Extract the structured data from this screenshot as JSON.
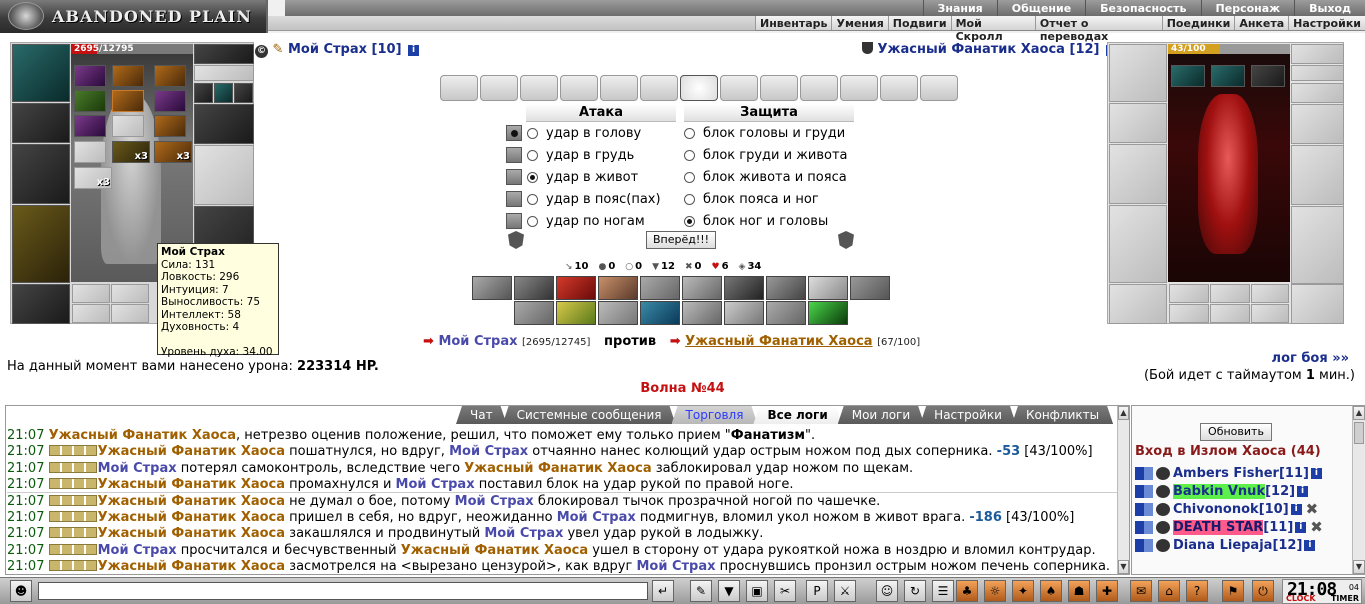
{
  "logo": {
    "text": "ABANDONED PLAIN"
  },
  "menu_top": [
    "Знания",
    "Общение",
    "Безопасность",
    "Персонаж",
    "Выход"
  ],
  "menu_sub": [
    "Инвентарь",
    "Умения",
    "Подвиги",
    "Мой Скролл",
    "Отчет о переводах",
    "Поединки",
    "Анкета",
    "Настройки"
  ],
  "player": {
    "name": "Мой Страх",
    "level": "[10]",
    "hp": "2695/12795",
    "hp_fraction": 0.21,
    "multipliers": [
      "x3",
      "x3",
      "x3"
    ],
    "tooltip": {
      "title": "Мой Страх",
      "lines": [
        "Сила: 131",
        "Ловкость: 296",
        "Интуиция: 7",
        "Выносливость: 75",
        "Интеллект: 58",
        "Духовность: 4"
      ],
      "spirit": "Уровень духа: 34.00"
    }
  },
  "enemy": {
    "name": "Ужасный Фанатик Хаоса",
    "level": "[12]",
    "hp": "43/100",
    "hp_fraction": 0.43
  },
  "combat": {
    "attack_header": "Атака",
    "defense_header": "Защита",
    "attacks": [
      {
        "label": "удар в голову",
        "checked": true,
        "selected": false
      },
      {
        "label": "удар в грудь",
        "checked": false,
        "selected": false
      },
      {
        "label": "удар в живот",
        "checked": false,
        "selected": true
      },
      {
        "label": "удар в пояс(пах)",
        "checked": false,
        "selected": false
      },
      {
        "label": "удар по ногам",
        "checked": false,
        "selected": false
      }
    ],
    "defenses": [
      {
        "label": "блок головы и груди",
        "selected": false
      },
      {
        "label": "блок груди и живота",
        "selected": false
      },
      {
        "label": "блок живота и пояса",
        "selected": false
      },
      {
        "label": "блок пояса и ног",
        "selected": false
      },
      {
        "label": "блок ног и головы",
        "selected": true
      }
    ],
    "forward_button": "Вперёд!!!",
    "stats": [
      "10",
      "0",
      "0",
      "12",
      "0",
      "6",
      "34"
    ]
  },
  "versus": {
    "me": "Мой Страх",
    "me_hp": "[2695/12745]",
    "word": "против",
    "foe": "Ужасный Фанатик Хаоса",
    "foe_hp": "[67/100]"
  },
  "damage": {
    "label": "На данный момент вами нанесено урона:",
    "value": "223314 HP."
  },
  "battle_log_link": "лог боя »»",
  "timeout": {
    "prefix": "(Бой идет с таймаутом ",
    "value": "1",
    "suffix": " мин.)"
  },
  "wave": "Волна №44",
  "chat_tabs": [
    "Чат",
    "Системные сообщения",
    "Торговля",
    "Все логи",
    "Мои логи",
    "Настройки",
    "Конфликты"
  ],
  "log": [
    {
      "time": "21:07",
      "boxes": false,
      "actor": "Ужасный Фанатик Хаоса",
      "actor_type": "foe",
      "parts": [
        {
          "t": ", нетрезво оценив положение, решил, что поможет ему только прием \""
        },
        {
          "b": "Фанатизм"
        },
        {
          "t": "\"."
        }
      ]
    },
    {
      "time": "21:07",
      "boxes": true,
      "actor": "Ужасный Фанатик Хаоса",
      "actor_type": "foe",
      "parts": [
        {
          "t": " пошатнулся, но вдруг, "
        },
        {
          "n2": "Мой Страх"
        },
        {
          "t": " отчаянно нанес колющий удар острым ножом под дых соперника. "
        },
        {
          "d": "-53"
        },
        {
          "t": " [43/100%]"
        }
      ]
    },
    {
      "time": "21:07",
      "boxes": true,
      "actor": "Мой Страх",
      "actor_type": "me",
      "parts": [
        {
          "t": " потерял самоконтроль, вследствие чего "
        },
        {
          "n1": "Ужасный Фанатик Хаоса"
        },
        {
          "t": " заблокировал удар ножом по щекам."
        }
      ]
    },
    {
      "time": "21:07",
      "boxes": true,
      "actor": "Ужасный Фанатик Хаоса",
      "actor_type": "foe",
      "parts": [
        {
          "t": " промахнулся и "
        },
        {
          "n2": "Мой Страх"
        },
        {
          "t": " поставил блок на удар рукой по правой ноге."
        }
      ]
    },
    {
      "time": "21:07",
      "boxes": true,
      "actor": "Ужасный Фанатик Хаоса",
      "actor_type": "foe",
      "parts": [
        {
          "t": " не думал о бое, потому "
        },
        {
          "n2": "Мой Страх"
        },
        {
          "t": " блокировал тычок прозрачной ногой по чашечке."
        }
      ]
    },
    {
      "time": "21:07",
      "boxes": true,
      "actor": "Ужасный Фанатик Хаоса",
      "actor_type": "foe",
      "parts": [
        {
          "t": " пришел в себя, но вдруг, неожиданно "
        },
        {
          "n2": "Мой Страх"
        },
        {
          "t": " подмигнув, вломил укол ножом в живот врага. "
        },
        {
          "d": "-186"
        },
        {
          "t": " [43/100%]"
        }
      ]
    },
    {
      "time": "21:07",
      "boxes": true,
      "actor": "Ужасный Фанатик Хаоса",
      "actor_type": "foe",
      "parts": [
        {
          "t": " закашлялся и продвинутый "
        },
        {
          "n2": "Мой Страх"
        },
        {
          "t": " увел удар рукой в лодыжку."
        }
      ]
    },
    {
      "time": "21:07",
      "boxes": true,
      "actor": "Мой Страх",
      "actor_type": "me",
      "parts": [
        {
          "t": " просчитался и бесчувственный "
        },
        {
          "n1": "Ужасный Фанатик Хаоса"
        },
        {
          "t": " ушел в сторону от удара рукояткой ножа в ноздрю и вломил контрудар."
        }
      ]
    },
    {
      "time": "21:07",
      "boxes": true,
      "actor": "Ужасный Фанатик Хаоса",
      "actor_type": "foe",
      "parts": [
        {
          "t": " засмотрелся на <вырезано цензурой>, как вдруг "
        },
        {
          "n2": "Мой Страх"
        },
        {
          "t": " проснувшись пронзил острым ножом печень соперника."
        }
      ]
    }
  ],
  "side": {
    "refresh": "Обновить",
    "title": "Вход в Излом Хаоса (44)",
    "users": [
      {
        "name": "Ambers Fisher",
        "level": "[11]",
        "hl": ""
      },
      {
        "name": "Babkin Vnuk",
        "level": "[12]",
        "hl": "green"
      },
      {
        "name": "Chivononok",
        "level": "[10]",
        "hl": "",
        "x": true
      },
      {
        "name": "DEATH STAR",
        "level": "[11]",
        "hl": "red",
        "x": true
      },
      {
        "name": "Diana Liepaja",
        "level": "[12]",
        "hl": ""
      }
    ]
  },
  "clock": {
    "time": "21:08",
    "seconds": "04",
    "left": "CLOCK",
    "right": "TIMER"
  },
  "colors": {
    "accent_blue": "#1a2e8c",
    "foe_gold": "#a06000",
    "wave_red": "#c41010",
    "chat_time": "#0a5a0a"
  }
}
